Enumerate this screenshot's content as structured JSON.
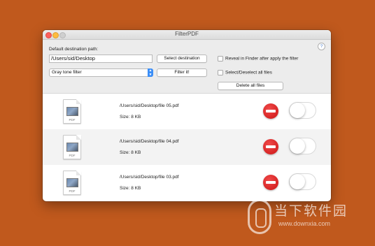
{
  "window": {
    "title": "FilterPDF"
  },
  "settings": {
    "destination_label": "Default destination path:",
    "destination_path": "/Users/sid/Desktop",
    "select_destination_label": "Select destination",
    "filter_selected": "Gray tone filter",
    "filter_button_label": "Filter it!",
    "reveal_in_finder_label": "Reveal in Finder after apply the filter",
    "reveal_in_finder_checked": false,
    "select_all_label": "Select/Deselect all files",
    "select_all_checked": false,
    "delete_all_label": "Delete all files",
    "help_symbol": "?"
  },
  "files": [
    {
      "path": "/Users/sid/Desktop/file 05.pdf",
      "size": "Size: 8 KB",
      "icon_label": "PDF",
      "enabled": false
    },
    {
      "path": "/Users/sid/Desktop/file 04.pdf",
      "size": "Size: 8 KB",
      "icon_label": "PDF",
      "enabled": false
    },
    {
      "path": "/Users/sid/Desktop/file 03.pdf",
      "size": "Size: 8 KB",
      "icon_label": "PDF",
      "enabled": false
    }
  ],
  "watermark": {
    "name": "当下软件园",
    "url": "www.downxia.com"
  },
  "colors": {
    "desktop": "#c0591d",
    "accent": "#3b8ef7",
    "delete": "#d61a1a"
  }
}
